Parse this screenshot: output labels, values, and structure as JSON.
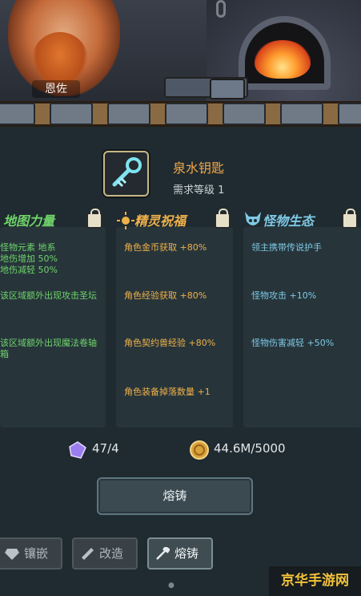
{
  "scene": {
    "npc_name": "恩佐"
  },
  "item": {
    "name": "泉水钥匙",
    "level_req": "需求等级 1"
  },
  "columns": [
    {
      "title": "地图力量",
      "color": "#6fd36a",
      "entries": [
        "怪物元素 地系\n地伤增加 50%\n地伤减轻 50%",
        "该区域额外出现攻击圣坛",
        "该区域额外出现魔法卷轴\n箱"
      ]
    },
    {
      "title": "精灵祝福",
      "color": "#efb04a",
      "entries": [
        "角色金币获取 +80%",
        "角色经验获取 +80%",
        "角色契约兽经验 +80%",
        "角色装备掉落数量 +1"
      ]
    },
    {
      "title": "怪物生态",
      "color": "#7fc9e5",
      "entries": [
        "领主携带传说护手",
        "怪物攻击 +10%",
        "怪物伤害减轻 +50%"
      ]
    }
  ],
  "resources": {
    "crystal": "47/4",
    "gold": "44.6M/5000"
  },
  "forge_button": "熔铸",
  "tabs": [
    {
      "label": "镶嵌",
      "icon": "gem-icon",
      "active": false
    },
    {
      "label": "改造",
      "icon": "wrench-icon",
      "active": false
    },
    {
      "label": "熔铸",
      "icon": "hammer-icon",
      "active": true
    }
  ],
  "watermark": "京华手游网"
}
